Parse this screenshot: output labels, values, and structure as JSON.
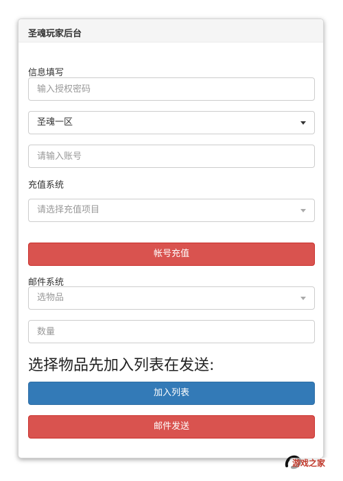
{
  "panel": {
    "title": "圣魂玩家后台"
  },
  "form": {
    "info_label": "信息填写",
    "auth_placeholder": "输入授权密码",
    "server_selected": "圣魂一区",
    "account_placeholder": "请输入账号",
    "recharge_label": "充值系统",
    "recharge_placeholder": "请选择充值项目",
    "recharge_button": "帐号充值",
    "mail_label": "邮件系统",
    "item_placeholder": "选物品",
    "quantity_placeholder": "数量",
    "instruction": "选择物品先加入列表在发送:",
    "add_list_button": "加入列表",
    "send_mail_button": "邮件发送"
  },
  "watermark": {
    "text": "游戏之家"
  },
  "colors": {
    "danger": "#d9534f",
    "primary": "#337ab7"
  }
}
